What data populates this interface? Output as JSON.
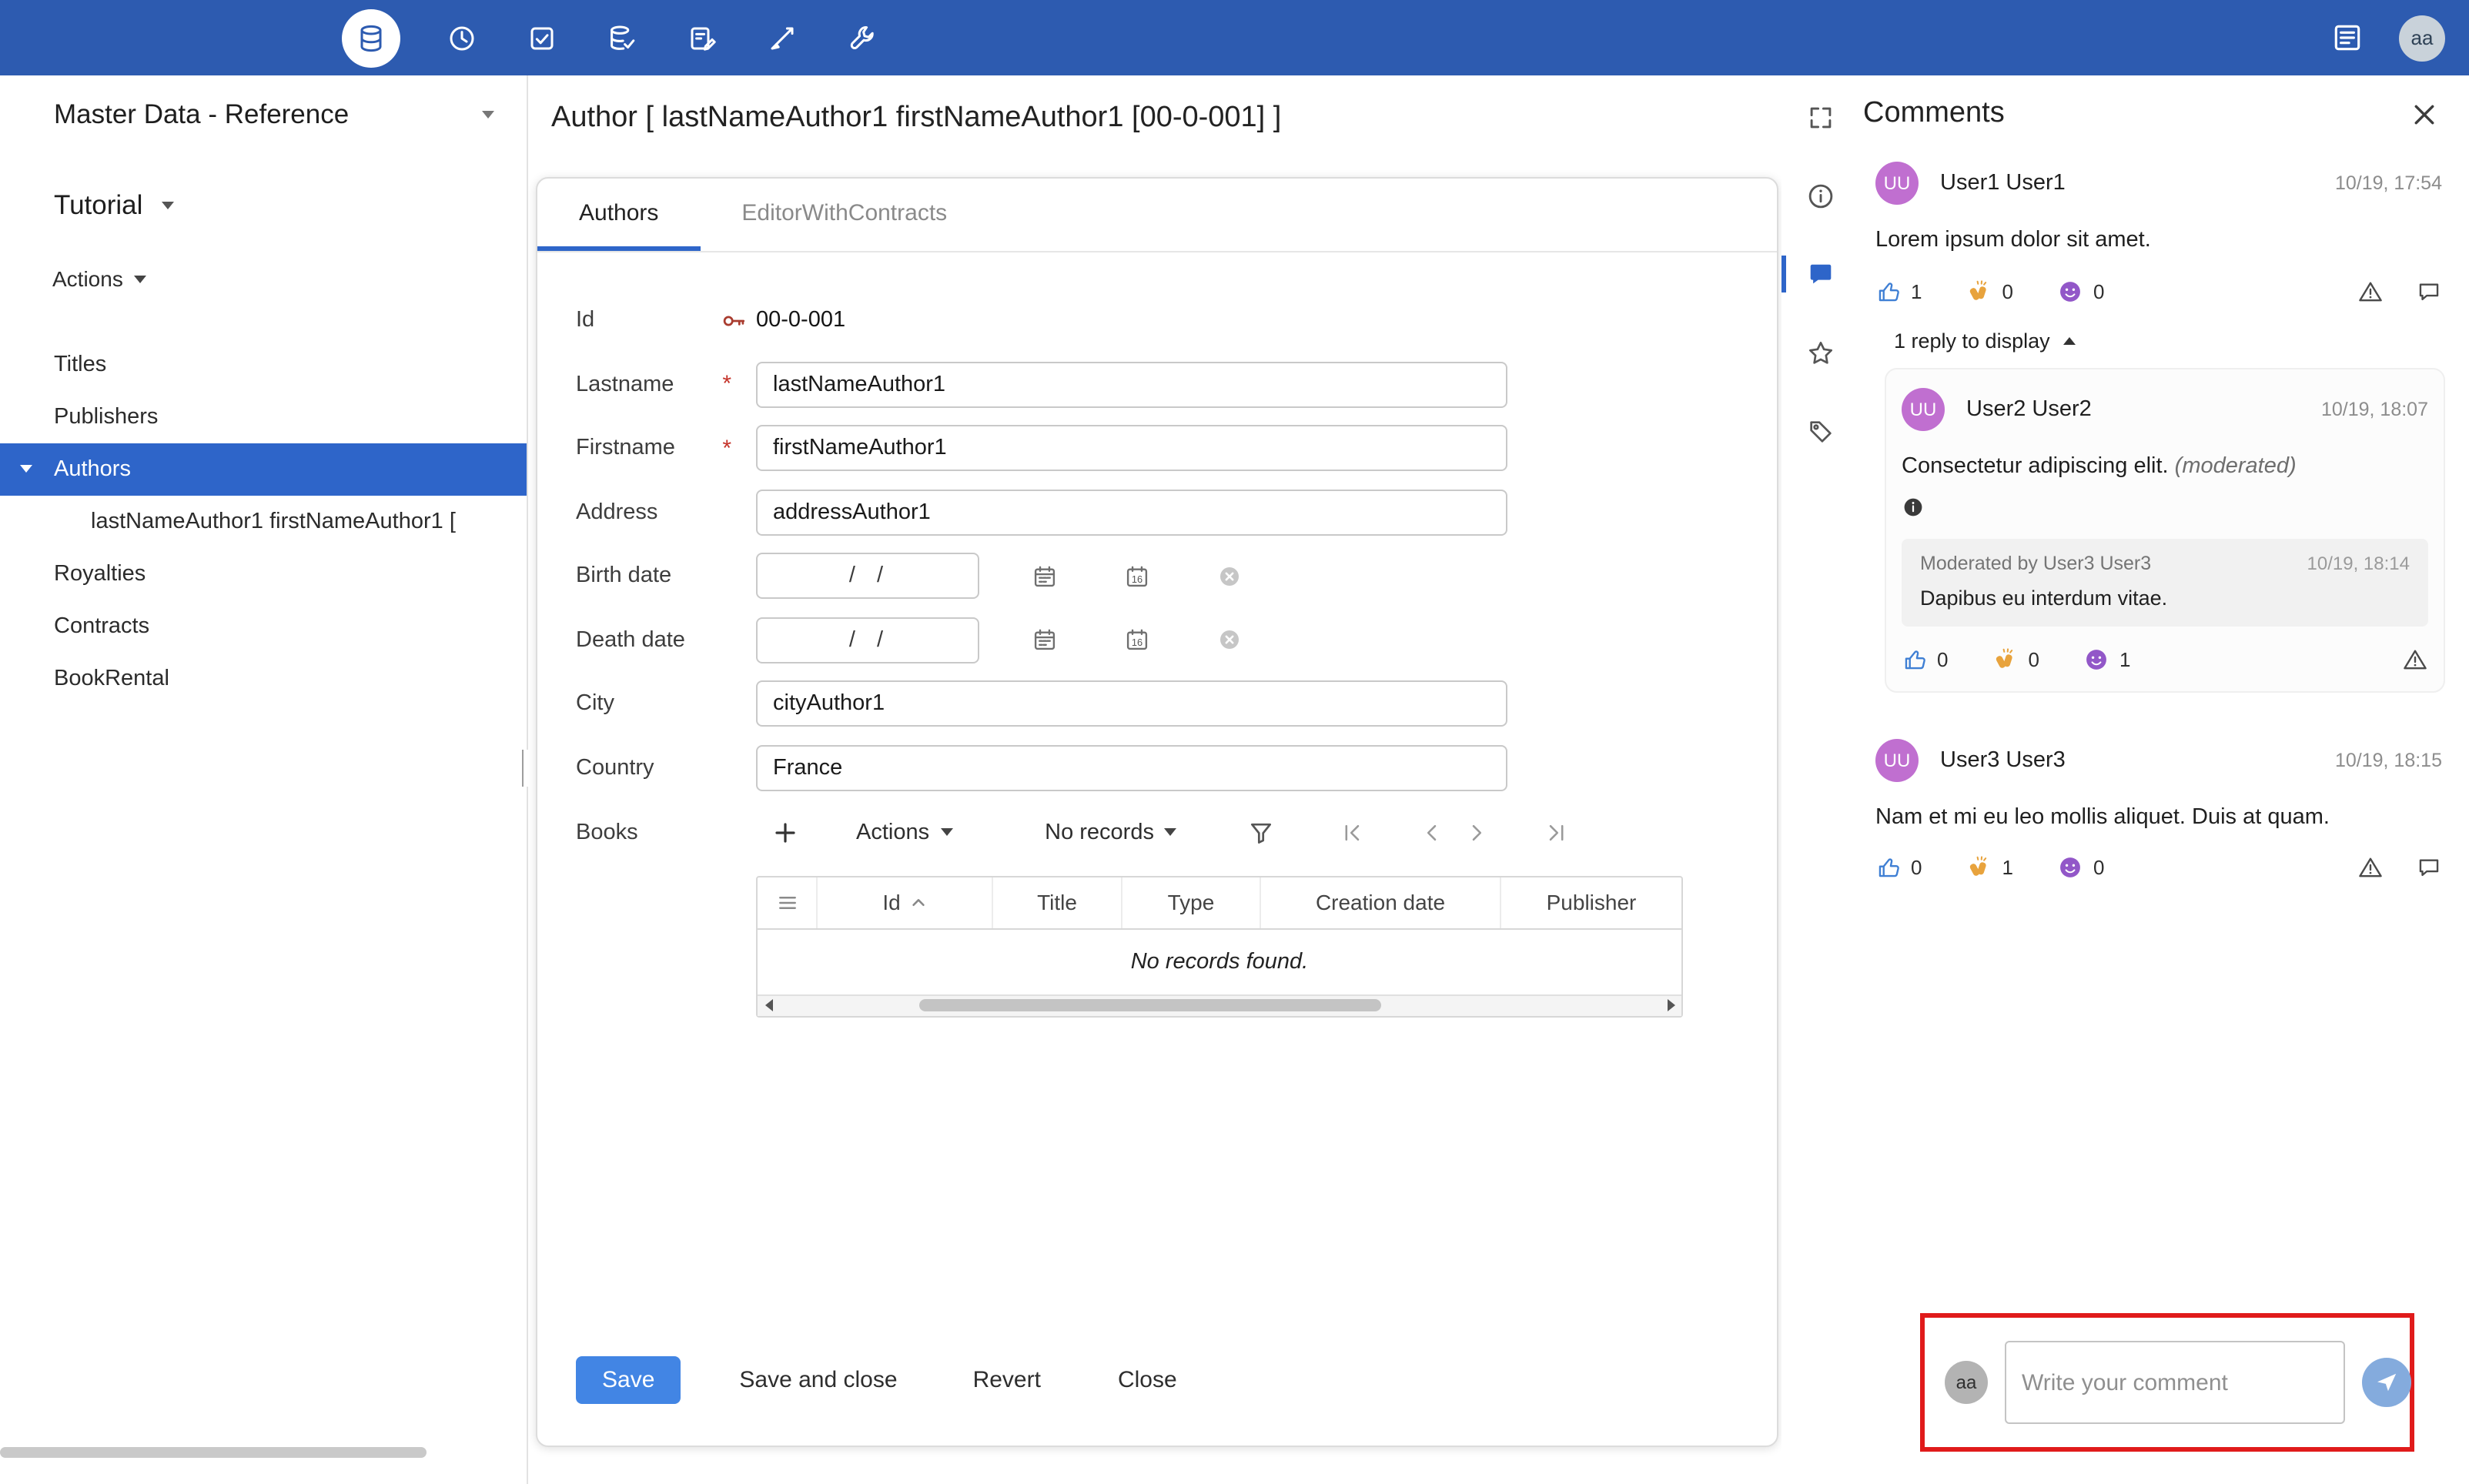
{
  "colors": {
    "topbar": "#2d5bb0",
    "accent": "#2e65c9",
    "save_button": "#4285e4",
    "annotation_highlight": "#e01b1b",
    "avatar_purple": "#c06fd0",
    "required": "#c5342b"
  },
  "topbar": {
    "avatar": "aa"
  },
  "sidebar": {
    "workspace": "Master Data - Reference",
    "dataset": "Tutorial",
    "actions": "Actions",
    "items": [
      {
        "label": "Titles"
      },
      {
        "label": "Publishers"
      },
      {
        "label": "Authors"
      },
      {
        "label": "lastNameAuthor1 firstNameAuthor1 ["
      },
      {
        "label": "Royalties"
      },
      {
        "label": "Contracts"
      },
      {
        "label": "BookRental"
      }
    ]
  },
  "main": {
    "title": "Author [ lastNameAuthor1 firstNameAuthor1 [00-0-001] ]",
    "tabs": [
      {
        "label": "Authors"
      },
      {
        "label": "EditorWithContracts"
      }
    ],
    "form": {
      "required_marker": "*",
      "id_label": "Id",
      "id_value": "00-0-001",
      "lastname_label": "Lastname",
      "lastname_value": "lastNameAuthor1",
      "firstname_label": "Firstname",
      "firstname_value": "firstNameAuthor1",
      "address_label": "Address",
      "address_value": "addressAuthor1",
      "birth_label": "Birth date",
      "birth_value": "/  /",
      "death_label": "Death date",
      "death_value": "/  /",
      "city_label": "City",
      "city_value": "cityAuthor1",
      "country_label": "Country",
      "country_value": "France",
      "books_label": "Books",
      "books_toolbar": {
        "actions": "Actions",
        "records": "No records"
      },
      "books_table": {
        "columns": [
          "Id",
          "Title",
          "Type",
          "Creation date",
          "Publisher"
        ],
        "empty_message": "No records found."
      }
    },
    "footer_buttons": {
      "save": "Save",
      "save_and_close": "Save and close",
      "revert": "Revert",
      "close": "Close"
    }
  },
  "comments": {
    "title": "Comments",
    "thread": {
      "comment1": {
        "initials": "UU",
        "author": "User1 User1",
        "timestamp": "10/19, 17:54",
        "text": "Lorem ipsum dolor sit amet.",
        "like_count": "1",
        "clap_count": "0",
        "face_count": "0"
      },
      "reply_toggle": "1 reply to display",
      "reply": {
        "initials": "UU",
        "author": "User2 User2",
        "timestamp": "10/19, 18:07",
        "text": "Consectetur adipiscing elit. ",
        "moderated_label": "(moderated)",
        "moderation_title": "Moderated by User3 User3",
        "moderation_timestamp": "10/19, 18:14",
        "moderation_text": "Dapibus eu interdum vitae.",
        "like_count": "0",
        "clap_count": "0",
        "face_count": "1"
      },
      "comment2": {
        "initials": "UU",
        "author": "User3 User3",
        "timestamp": "10/19, 18:15",
        "text": "Nam et mi eu leo mollis aliquet. Duis at quam.",
        "like_count": "0",
        "clap_count": "1",
        "face_count": "0"
      }
    },
    "composer": {
      "avatar": "aa",
      "placeholder": "Write your comment"
    }
  }
}
